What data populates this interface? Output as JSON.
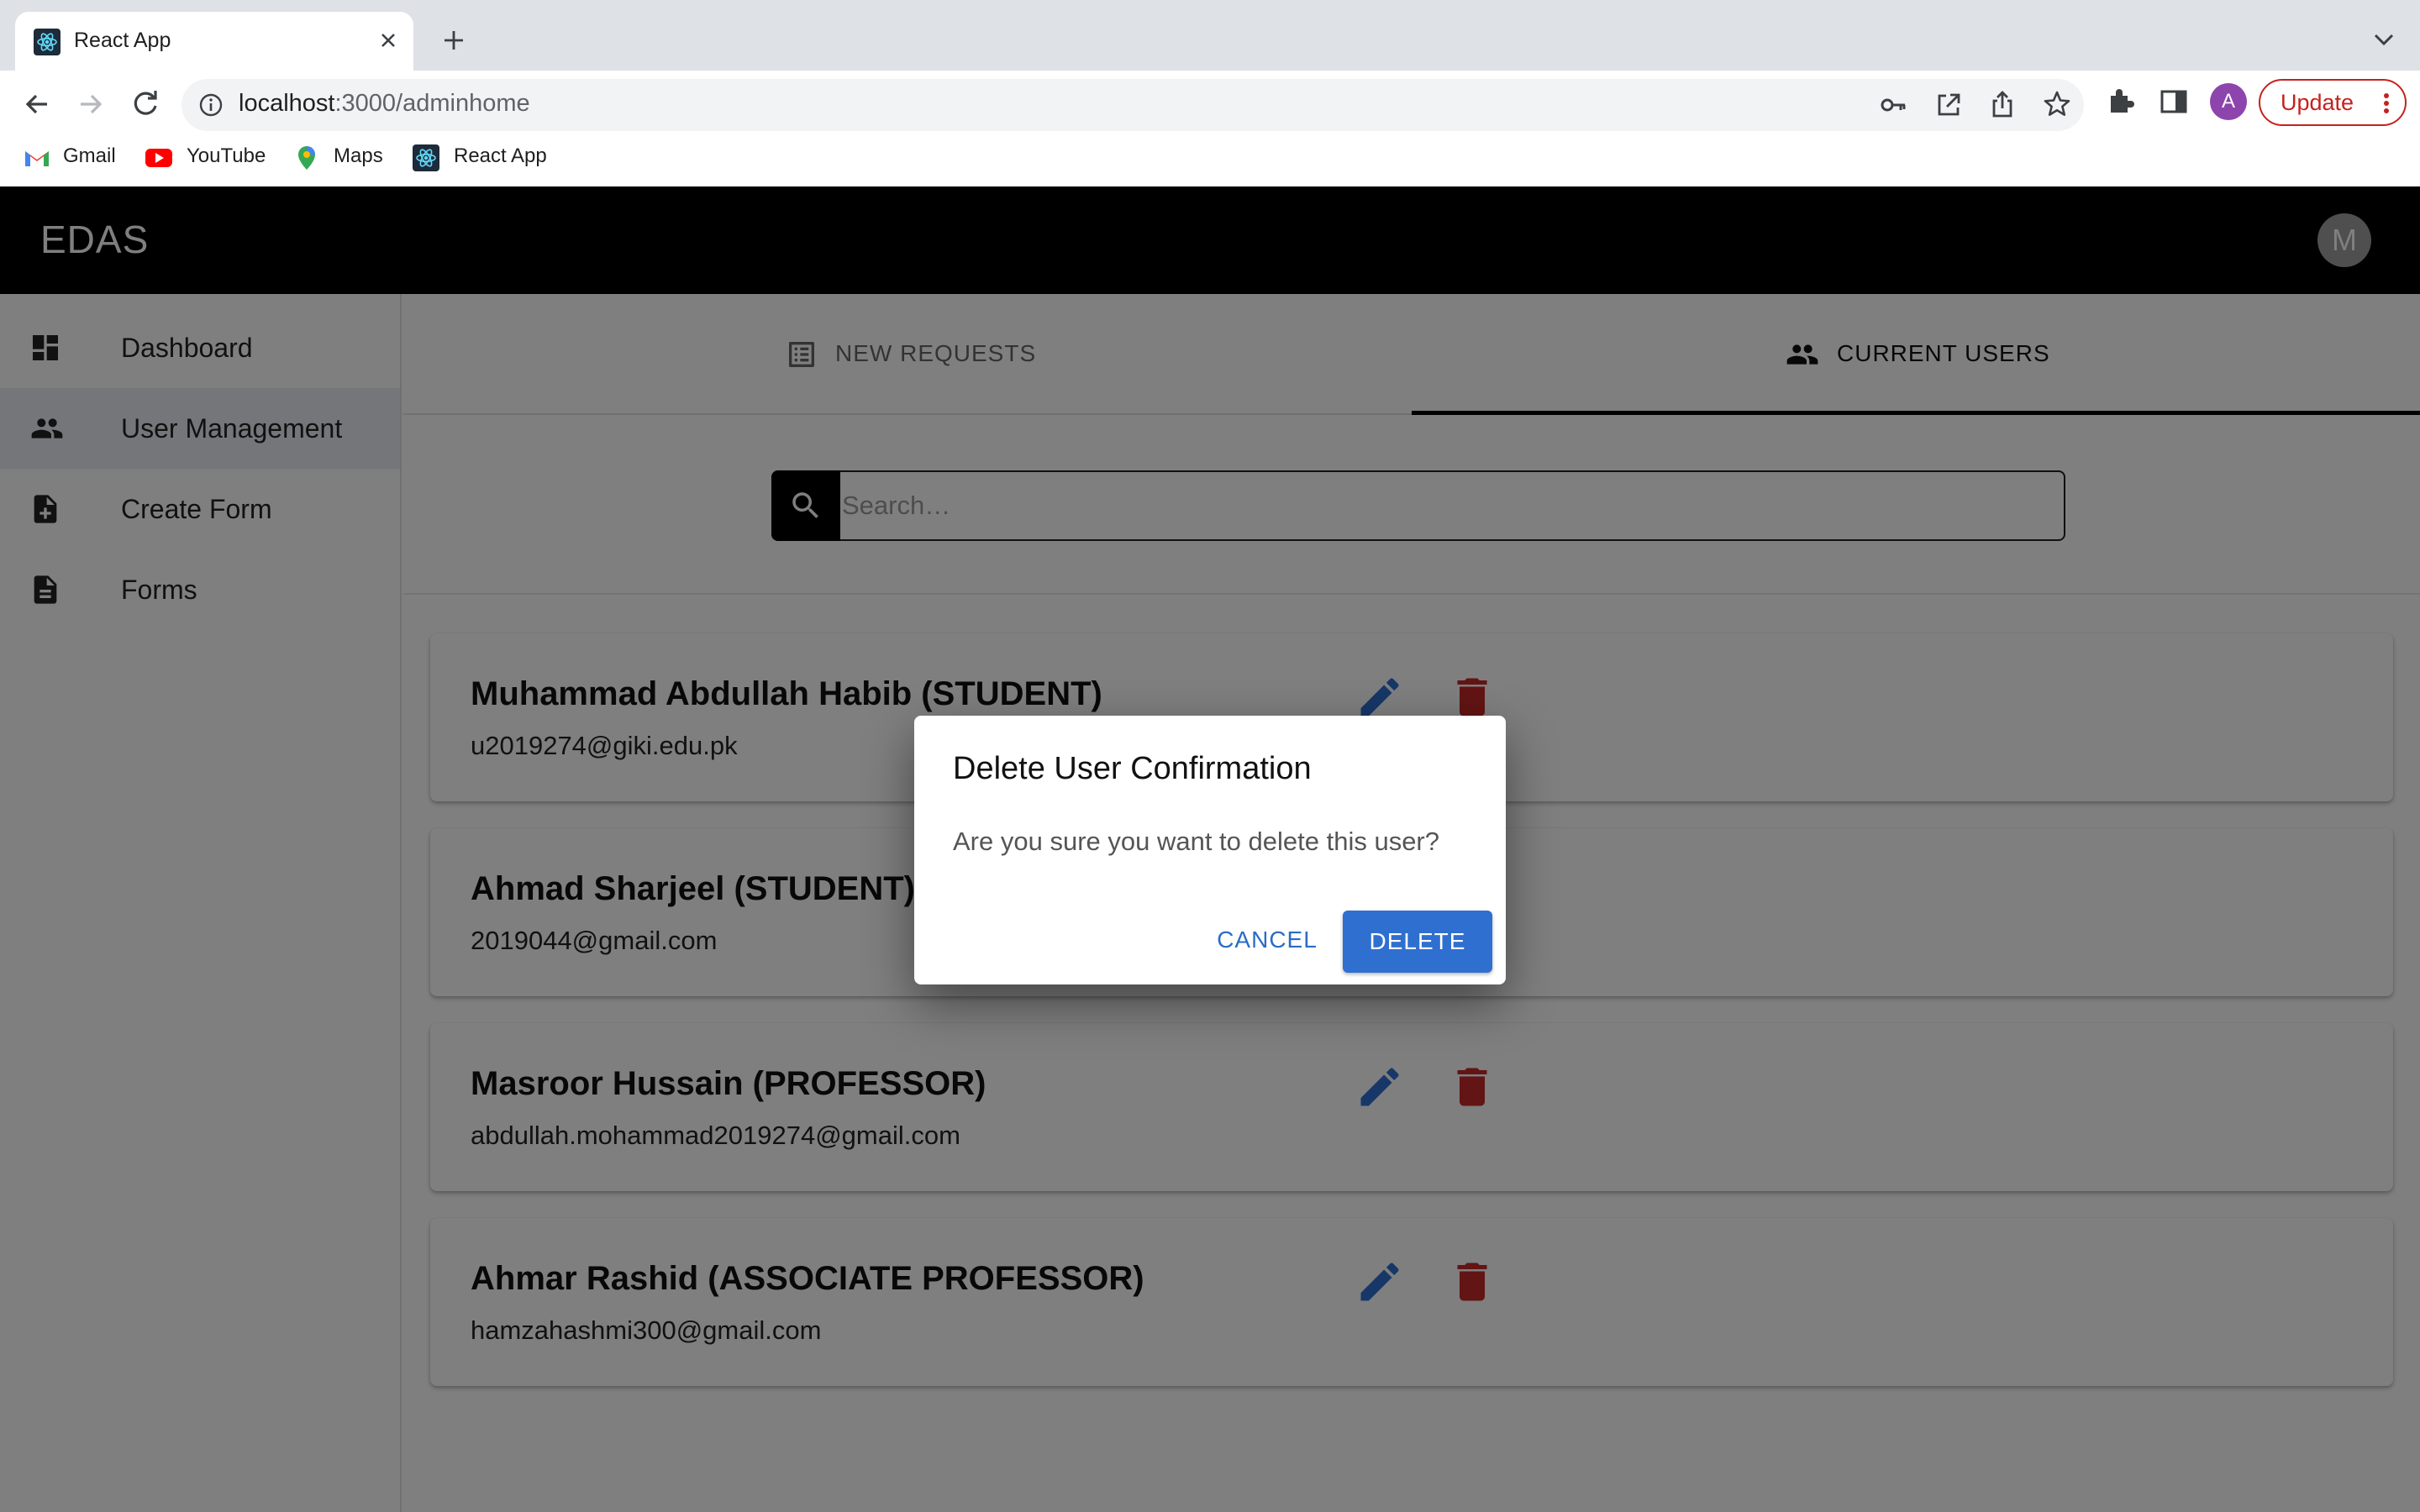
{
  "browser": {
    "tab_title": "React App",
    "url_host": "localhost",
    "url_path": ":3000/adminhome",
    "update_label": "Update",
    "profile_initial": "A",
    "bookmarks": [
      "Gmail",
      "YouTube",
      "Maps",
      "React App"
    ]
  },
  "app": {
    "title": "EDAS",
    "user_initial": "M"
  },
  "sidebar": {
    "items": [
      {
        "label": "Dashboard",
        "icon": "dashboard-icon"
      },
      {
        "label": "User Management",
        "icon": "people-icon",
        "selected": true
      },
      {
        "label": "Create Form",
        "icon": "note-add-icon"
      },
      {
        "label": "Forms",
        "icon": "document-icon"
      }
    ]
  },
  "tabs": {
    "new_requests": "NEW REQUESTS",
    "current_users": "CURRENT USERS",
    "active": "CURRENT USERS"
  },
  "search": {
    "placeholder": "Search…",
    "value": ""
  },
  "users": [
    {
      "name": "Muhammad Abdullah Habib (STUDENT)",
      "email": "u2019274@giki.edu.pk"
    },
    {
      "name": "Ahmad Sharjeel (STUDENT)",
      "email": "2019044@gmail.com"
    },
    {
      "name": "Masroor Hussain (PROFESSOR)",
      "email": "abdullah.mohammad2019274@gmail.com"
    },
    {
      "name": "Ahmar Rashid (ASSOCIATE PROFESSOR)",
      "email": "hamzahashmi300@gmail.com"
    }
  ],
  "dialog": {
    "title": "Delete User Confirmation",
    "message": "Are you sure you want to delete this user?",
    "cancel_label": "CANCEL",
    "delete_label": "DELETE"
  },
  "colors": {
    "accent": "#2f6fd0",
    "danger": "#c62828",
    "appbar": "#000000"
  }
}
